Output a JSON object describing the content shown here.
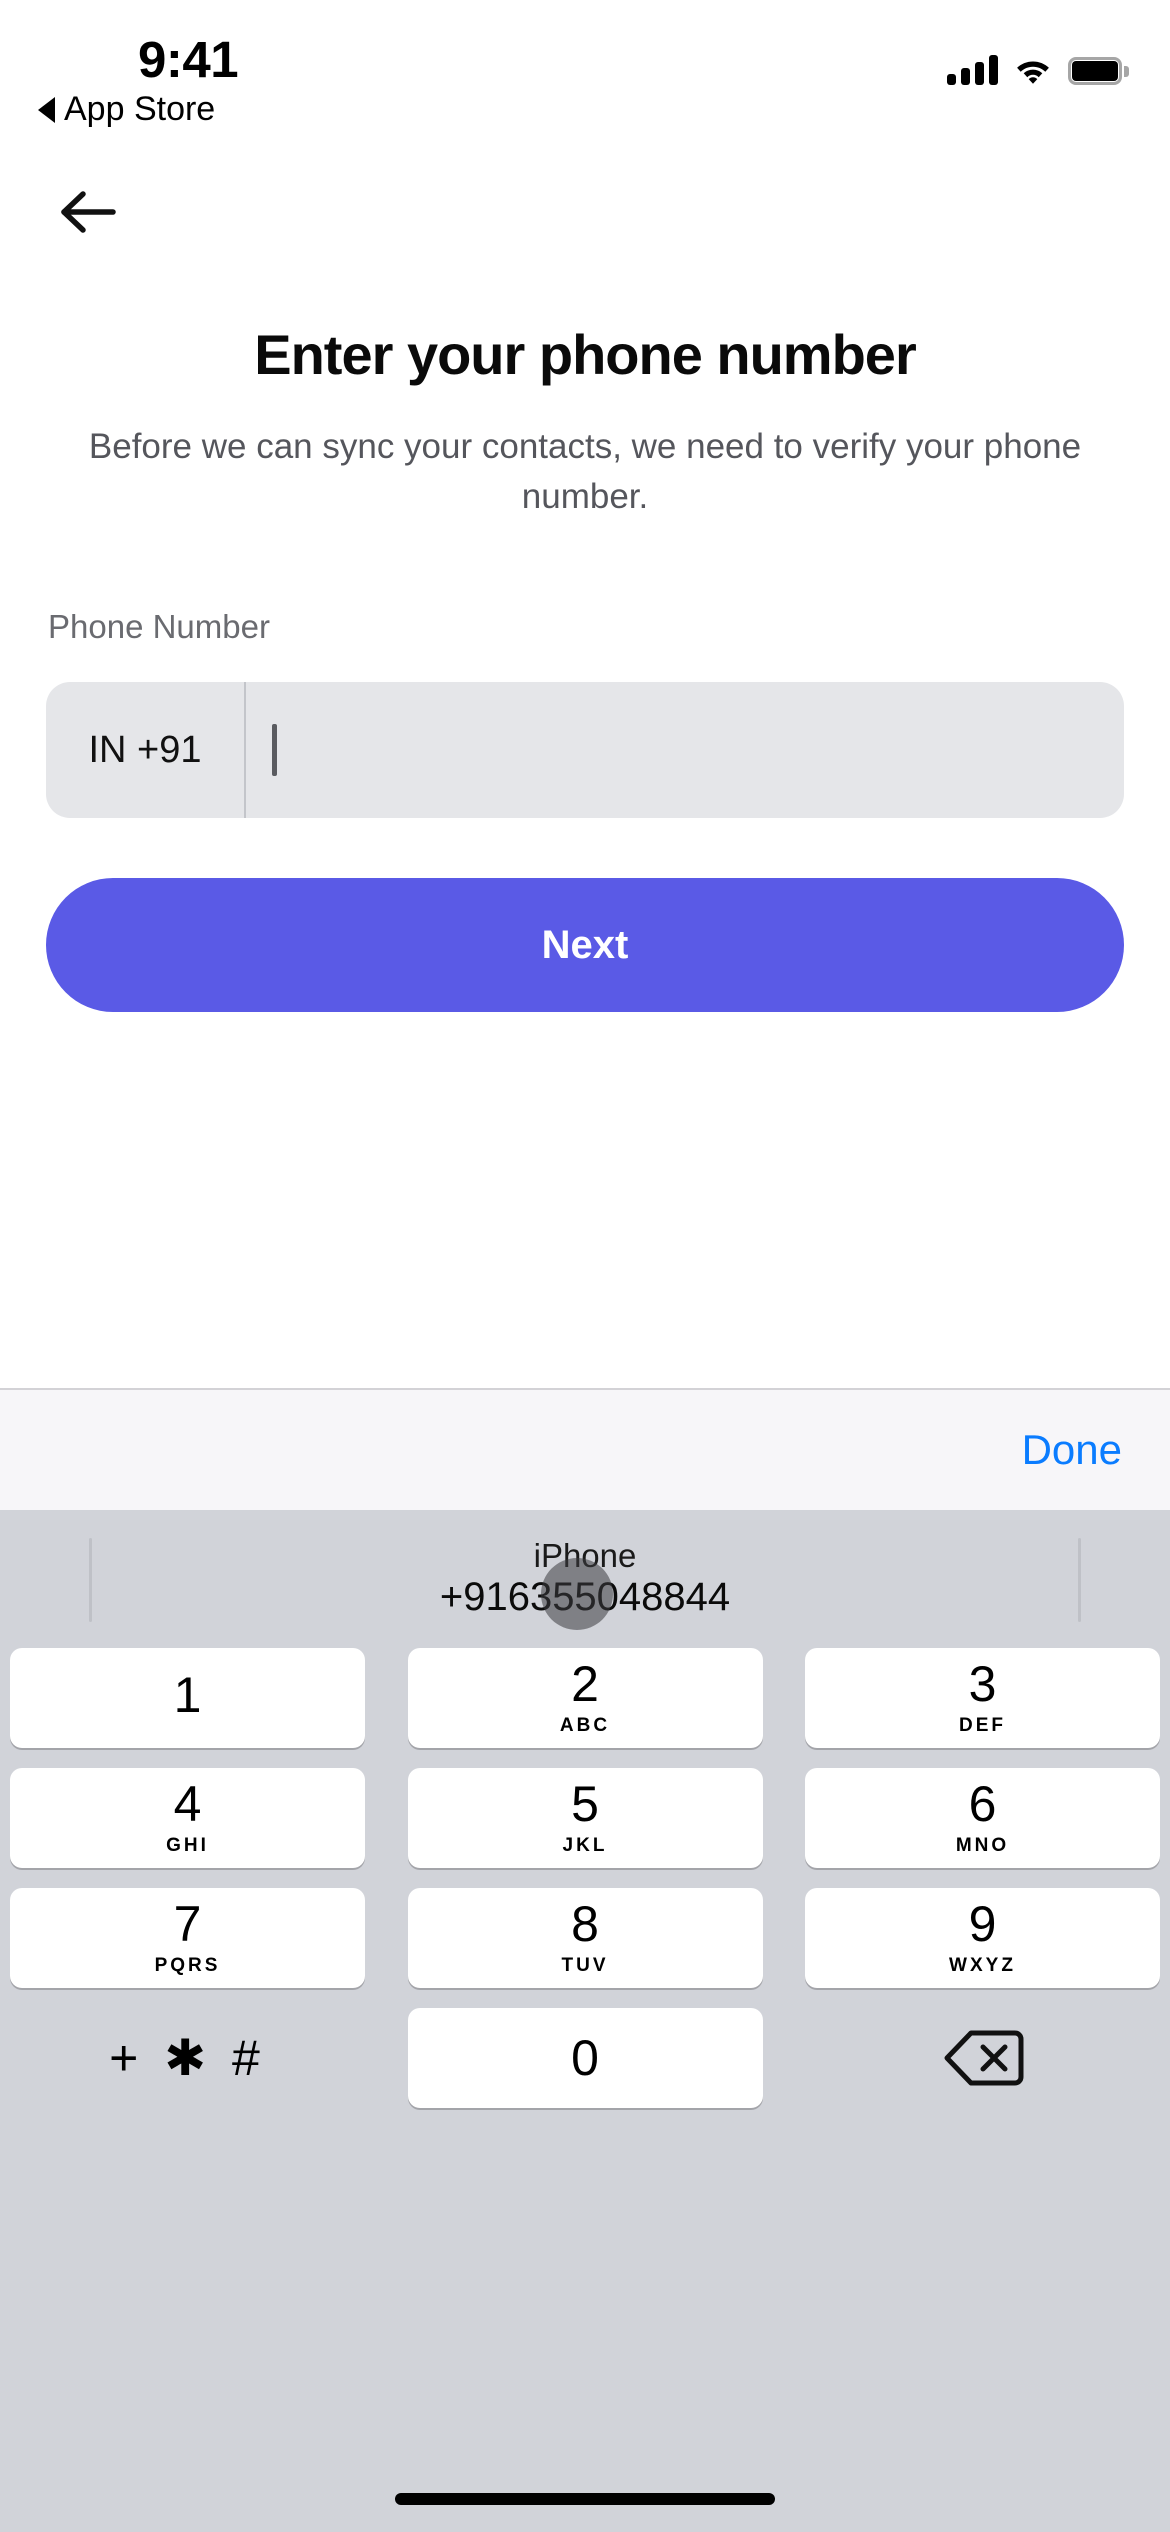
{
  "status_bar": {
    "time": "9:41",
    "back_app_label": "App Store",
    "back_app_icon": "triangle-left-icon",
    "cellular_icon": "cellular-signal-icon",
    "wifi_icon": "wifi-icon",
    "battery_icon": "battery-full-icon"
  },
  "nav": {
    "back_icon": "arrow-left-icon"
  },
  "content": {
    "title": "Enter your phone number",
    "subtitle": "Before we can sync your contacts, we need to verify your phone number.",
    "field_label": "Phone Number",
    "country_code": "IN +91",
    "phone_value": "",
    "phone_placeholder": "",
    "next_label": "Next"
  },
  "keyboard_toolbar": {
    "done_label": "Done"
  },
  "keyboard": {
    "suggestion_label": "iPhone",
    "suggestion_value": "+916355048844",
    "rows": [
      [
        {
          "num": "1",
          "letters": ""
        },
        {
          "num": "2",
          "letters": "ABC"
        },
        {
          "num": "3",
          "letters": "DEF"
        }
      ],
      [
        {
          "num": "4",
          "letters": "GHI"
        },
        {
          "num": "5",
          "letters": "JKL"
        },
        {
          "num": "6",
          "letters": "MNO"
        }
      ],
      [
        {
          "num": "7",
          "letters": "PQRS"
        },
        {
          "num": "8",
          "letters": "TUV"
        },
        {
          "num": "9",
          "letters": "WXYZ"
        }
      ]
    ],
    "bottom_row": {
      "symbols_label": "+ ✱ #",
      "zero": "0",
      "delete_icon": "backspace-delete-icon"
    }
  },
  "colors": {
    "accent": "#5a5ae6",
    "link": "#0a7cff",
    "field_bg": "#e5e6e9",
    "keyboard_bg": "#d1d3d9",
    "toolbar_bg": "#f7f6f9",
    "key_bg": "#ffffff"
  }
}
